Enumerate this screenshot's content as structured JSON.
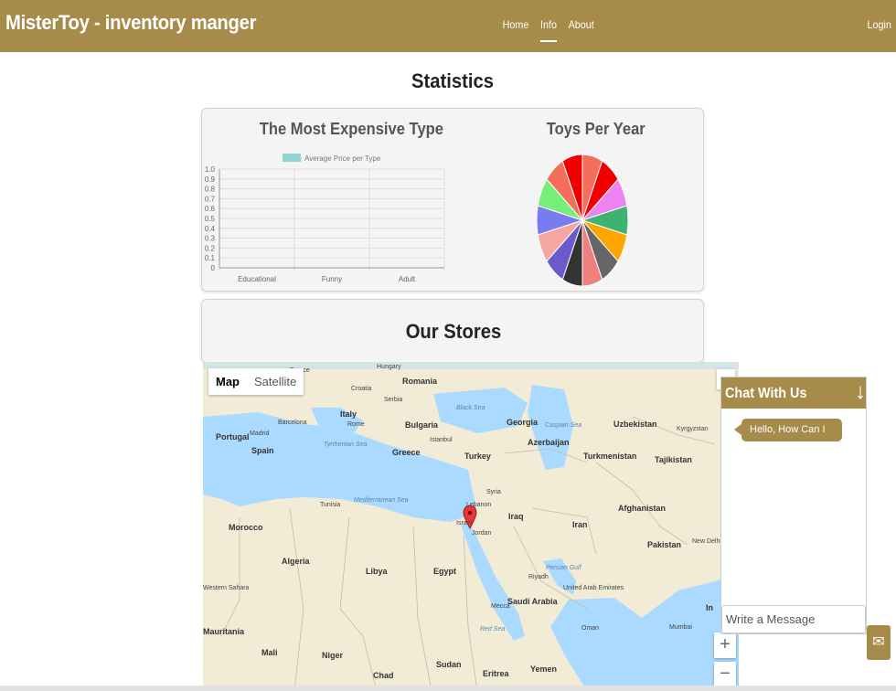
{
  "navbar": {
    "brand": "MisterToy - inventory manger",
    "links": [
      "Home",
      "Info",
      "About"
    ],
    "active_link": "Info",
    "login": "Login",
    "bg_color": "#a78b4b"
  },
  "page_title": "Statistics",
  "chart_data": [
    {
      "type": "bar",
      "title": "The Most Expensive Type",
      "legend": [
        "Average Price per Type"
      ],
      "categories": [
        "Educational",
        "Funny",
        "Adult"
      ],
      "series": [
        {
          "name": "Average Price per Type",
          "values": [
            0,
            0,
            0
          ],
          "color": "#8fd3d3"
        }
      ],
      "ylim": [
        0,
        1.0
      ],
      "yticks": [
        "0",
        "0.1",
        "0.2",
        "0.3",
        "0.4",
        "0.5",
        "0.6",
        "0.7",
        "0.8",
        "0.9",
        "1.0"
      ],
      "grid": true,
      "legend_position": "top"
    },
    {
      "type": "pie",
      "title": "Toys Per Year",
      "values": [
        1,
        1,
        1,
        1,
        1,
        1,
        1,
        1,
        1,
        1,
        1,
        1,
        1,
        1
      ],
      "colors": [
        "#f46f5b",
        "#f00000",
        "#ee82ee",
        "#3cb371",
        "#ffa500",
        "#666666",
        "#f08080",
        "#333333",
        "#6a5acd",
        "#f4a7a0",
        "#7b7bf0",
        "#77ee77",
        "#f46f5b",
        "#f00000"
      ]
    }
  ],
  "stores": {
    "title": "Our Stores",
    "map_types": [
      "Map",
      "Satellite"
    ],
    "selected_map_type": "Map",
    "zoom_in": "+",
    "zoom_out": "−",
    "labels": [
      {
        "text": "Hungary"
      },
      {
        "text": "Romania"
      },
      {
        "text": "Croatia"
      },
      {
        "text": "Serbia"
      },
      {
        "text": "Italy"
      },
      {
        "text": "Rome"
      },
      {
        "text": "Bulgaria"
      },
      {
        "text": "Black Sea"
      },
      {
        "text": "Georgia"
      },
      {
        "text": "Caspian Sea"
      },
      {
        "text": "Uzbekistan"
      },
      {
        "text": "Kyrgyzstan"
      },
      {
        "text": "Portugal"
      },
      {
        "text": "Madrid"
      },
      {
        "text": "Spain"
      },
      {
        "text": "Barcelona"
      },
      {
        "text": "Tyrrhenian Sea"
      },
      {
        "text": "Istanbul"
      },
      {
        "text": "Azerbaijan"
      },
      {
        "text": "Greece"
      },
      {
        "text": "Turkey"
      },
      {
        "text": "Turkmenistan"
      },
      {
        "text": "Tajikistan"
      },
      {
        "text": "Syria"
      },
      {
        "text": "Tunisia"
      },
      {
        "text": "Mediterranean Sea"
      },
      {
        "text": "Lebanon"
      },
      {
        "text": "Afghanistan"
      },
      {
        "text": "Morocco"
      },
      {
        "text": "Israel"
      },
      {
        "text": "Iraq"
      },
      {
        "text": "Iran"
      },
      {
        "text": "Jordan"
      },
      {
        "text": "Pakistan"
      },
      {
        "text": "New Delhi"
      },
      {
        "text": "Algeria"
      },
      {
        "text": "Libya"
      },
      {
        "text": "Egypt"
      },
      {
        "text": "Riyadh"
      },
      {
        "text": "Persian Gulf"
      },
      {
        "text": "United Arab Emirates"
      },
      {
        "text": "Saudi Arabia"
      },
      {
        "text": "Mecca"
      },
      {
        "text": "Oman"
      },
      {
        "text": "Red Sea"
      },
      {
        "text": "Mauritania"
      },
      {
        "text": "Mali"
      },
      {
        "text": "Niger"
      },
      {
        "text": "Chad"
      },
      {
        "text": "Sudan"
      },
      {
        "text": "Eritrea"
      },
      {
        "text": "Yemen"
      },
      {
        "text": "Mumbai"
      },
      {
        "text": "Western Sahara"
      },
      {
        "text": "France"
      },
      {
        "text": "In"
      }
    ]
  },
  "chat": {
    "title": "Chat With Us",
    "greeting": "Hello, How Can I Help",
    "input_placeholder": "Write a Message"
  }
}
